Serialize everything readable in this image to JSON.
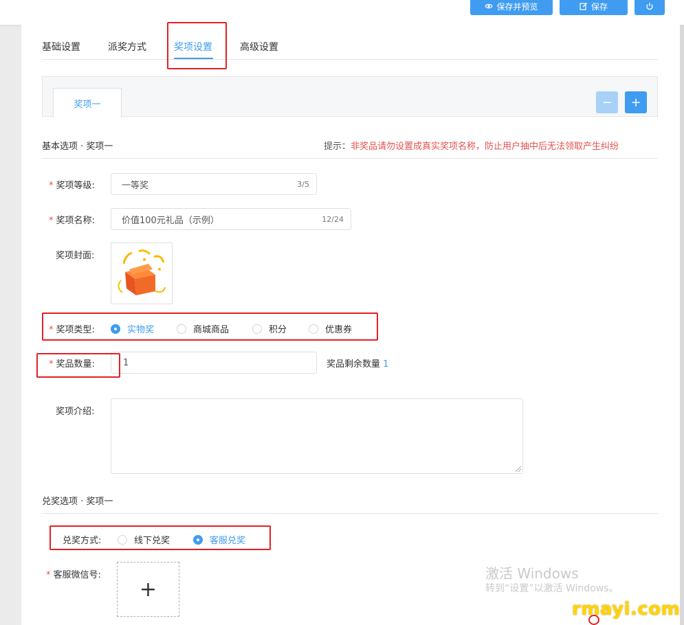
{
  "toolbar": {
    "preview_label": "保存并预览",
    "save_label": "保存"
  },
  "tabs": [
    {
      "label": "基础设置"
    },
    {
      "label": "派奖方式"
    },
    {
      "label": "奖项设置"
    },
    {
      "label": "高级设置"
    }
  ],
  "active_tab": "奖项设置",
  "prize_tabs": [
    {
      "label": "奖项一"
    }
  ],
  "prize_buttons": {
    "minus": "−",
    "plus": "+"
  },
  "basic_section": {
    "title": "基本选项 · 奖项一",
    "hint_label": "提示：",
    "hint_text": "非奖品请勿设置成真实奖项名称，防止用户抽中后无法领取产生纠纷"
  },
  "fields": {
    "level_label": "奖项等级:",
    "level_value": "一等奖",
    "level_count": "3/5",
    "name_label": "奖项名称:",
    "name_value": "价值100元礼品（示例）",
    "name_count": "12/24",
    "cover_label": "奖项封面:",
    "type_label": "奖项类型:",
    "type_options": [
      "实物奖",
      "商城商品",
      "积分",
      "优惠券"
    ],
    "type_selected": "实物奖",
    "qty_label": "奖品数量:",
    "qty_value": "1",
    "remaining_label": "奖品剩余数量",
    "remaining_value": "1",
    "intro_label": "奖项介绍:",
    "required_mark": "*"
  },
  "redeem_section": {
    "title": "兑奖选项 · 奖项一",
    "method_label": "兑奖方式:",
    "method_options": [
      "线下兑奖",
      "客服兑奖"
    ],
    "method_selected": "客服兑奖",
    "wechat_label": "客服微信号:",
    "upload_symbol": "+"
  },
  "watermark": {
    "title": "激活 Windows",
    "subtitle": "转到“设置”以激活 Windows。",
    "brand": "rmayi.com"
  },
  "colors": {
    "accent": "#3f9cf0",
    "required": "#e5504e",
    "annotation": "#e32024"
  }
}
